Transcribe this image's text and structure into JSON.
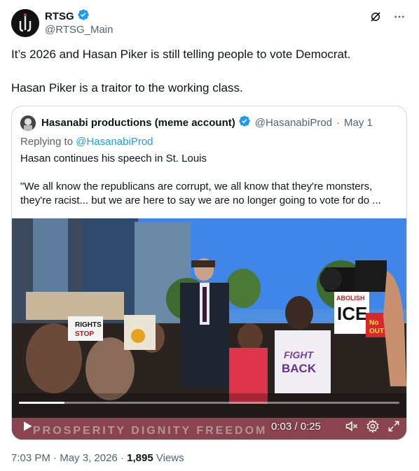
{
  "author": {
    "name": "RTSG",
    "handle": "@RTSG_Main",
    "verified": true
  },
  "tweet": {
    "line1": "It’s 2026 and Hasan Piker is still telling people to vote Democrat.",
    "line2": "Hasan Piker is a traitor to the working class."
  },
  "quoted": {
    "name": "Hasanabi productions (meme account)",
    "handle": "@HasanabiProd",
    "separator": "·",
    "date": "May 1",
    "reply_prefix": "Replying to",
    "reply_to": "@HasanabiProd",
    "text_line1": "Hasan continues his speech in St. Louis",
    "text_line2": "\"We all know the republicans are corrupt, we all know that they're monsters, they're racist... but we are here to say we are no longer going to vote for do ..."
  },
  "video": {
    "time_display": "0:03 / 0:25",
    "progress_fraction": 0.12,
    "sign_texts": [
      "FIGHT",
      "BACK",
      "ICE",
      "ABOLISH",
      "RIGHTS",
      "STOP",
      "No",
      "OUT"
    ],
    "banner_text": "PROSPERITY DIGNITY FREEDOM"
  },
  "footer": {
    "time": "7:03 PM",
    "separator": "·",
    "date": "May 3, 2026",
    "views_count": "1,895",
    "views_label": "Views"
  },
  "icons": {
    "verified": "verified-badge-icon",
    "grok": "grok-icon",
    "more": "more-icon",
    "play": "play-icon",
    "mute": "mute-icon",
    "settings": "gear-icon",
    "fullscreen": "fullscreen-icon"
  },
  "colors": {
    "accent": "#1d9bf0",
    "muted": "#536471",
    "text": "#0f1419",
    "border": "#cfd9de"
  }
}
